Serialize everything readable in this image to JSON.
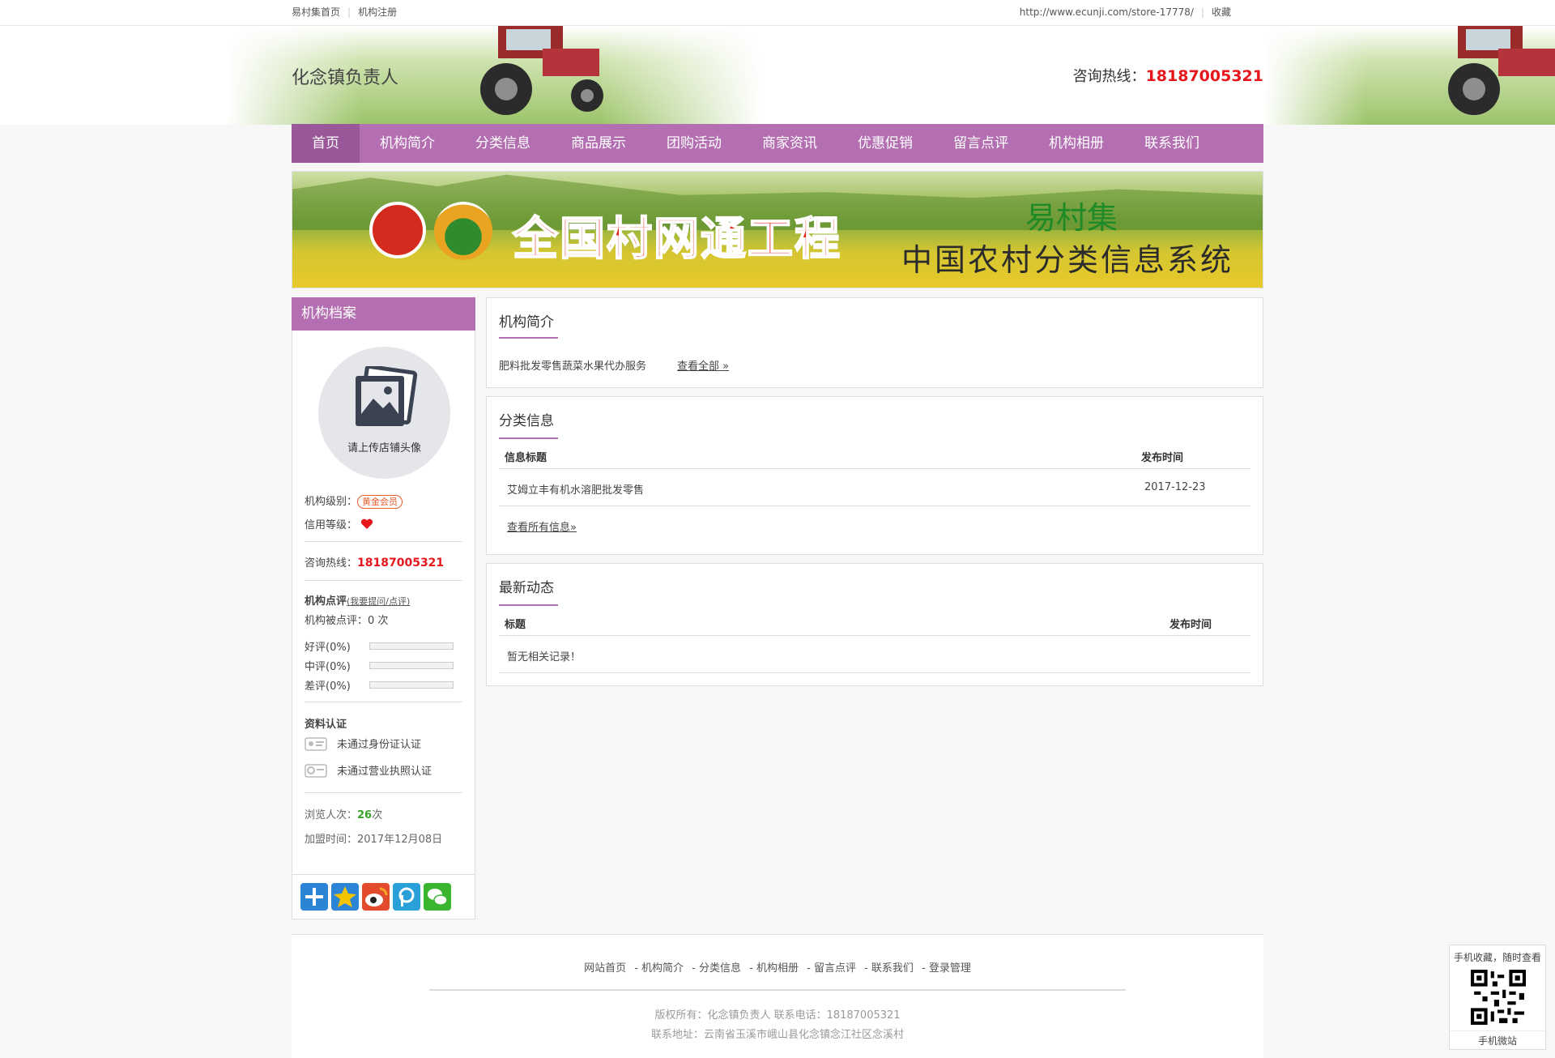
{
  "topbar": {
    "home_link": "易村集首页",
    "register_link": "机构注册",
    "url": "http://www.ecunji.com/store-17778/",
    "favorite": "收藏"
  },
  "header": {
    "shop_name": "化念镇负责人",
    "hotline_label": "咨询热线：",
    "hotline_number": "18187005321"
  },
  "nav": {
    "items": [
      "首页",
      "机构简介",
      "分类信息",
      "商品展示",
      "团购活动",
      "商家资讯",
      "优惠促销",
      "留言点评",
      "机构相册",
      "联系我们"
    ]
  },
  "banner": {
    "title": "全国村网通工程",
    "brand": "易村集",
    "subtitle": "中国农村分类信息系统"
  },
  "sidebar": {
    "title": "机构档案",
    "avatar_label": "请上传店铺头像",
    "level_label": "机构级别：",
    "level_value": "黄金会员",
    "credit_label": "信用等级：",
    "hotline_label": "咨询热线：",
    "hotline_number": "18187005321",
    "review_title": "机构点评",
    "review_link": "(我要提问/点评)",
    "review_count_label": "机构被点评：",
    "review_count": "0 次",
    "good": "好评(0%)",
    "mid": "中评(0%)",
    "bad": "差评(0%)",
    "good_pct": 0,
    "mid_pct": 0,
    "bad_pct": 0,
    "cert_title": "资料认证",
    "cert_id": "未通过身份证认证",
    "cert_license": "未通过营业执照认证",
    "views_label": "浏览人次：",
    "views_value": "26",
    "views_unit": "次",
    "join_label": "加盟时间：",
    "join_date": "2017年12月08日"
  },
  "intro_panel": {
    "title": "机构简介",
    "text": "肥料批发零售蔬菜水果代办服务",
    "more": "查看全部 »"
  },
  "info_panel": {
    "title": "分类信息",
    "col_title": "信息标题",
    "col_time": "发布时间",
    "rows": [
      {
        "title": "艾姆立丰有机水溶肥批发零售",
        "time": "2017-12-23"
      }
    ],
    "more": "查看所有信息»"
  },
  "news_panel": {
    "title": "最新动态",
    "col_title": "标题",
    "col_time": "发布时间",
    "empty": "暂无相关记录！"
  },
  "footer": {
    "links": [
      "网站首页",
      "- 机构简介",
      "- 分类信息",
      "- 机构相册",
      "- 留言点评",
      "- 联系我们",
      "- 登录管理"
    ],
    "copyright": "版权所有：化念镇负责人 联系电话：18187005321",
    "address": "联系地址：云南省玉溪市峨山县化念镇念江社区念溪村"
  },
  "qr": {
    "title": "手机收藏，随时查看",
    "bottom": "手机微站"
  },
  "colors": {
    "accent": "#b36fb1",
    "nav_active": "#9a579a",
    "hotline": "#e5161c",
    "views": "#3aa22a"
  }
}
